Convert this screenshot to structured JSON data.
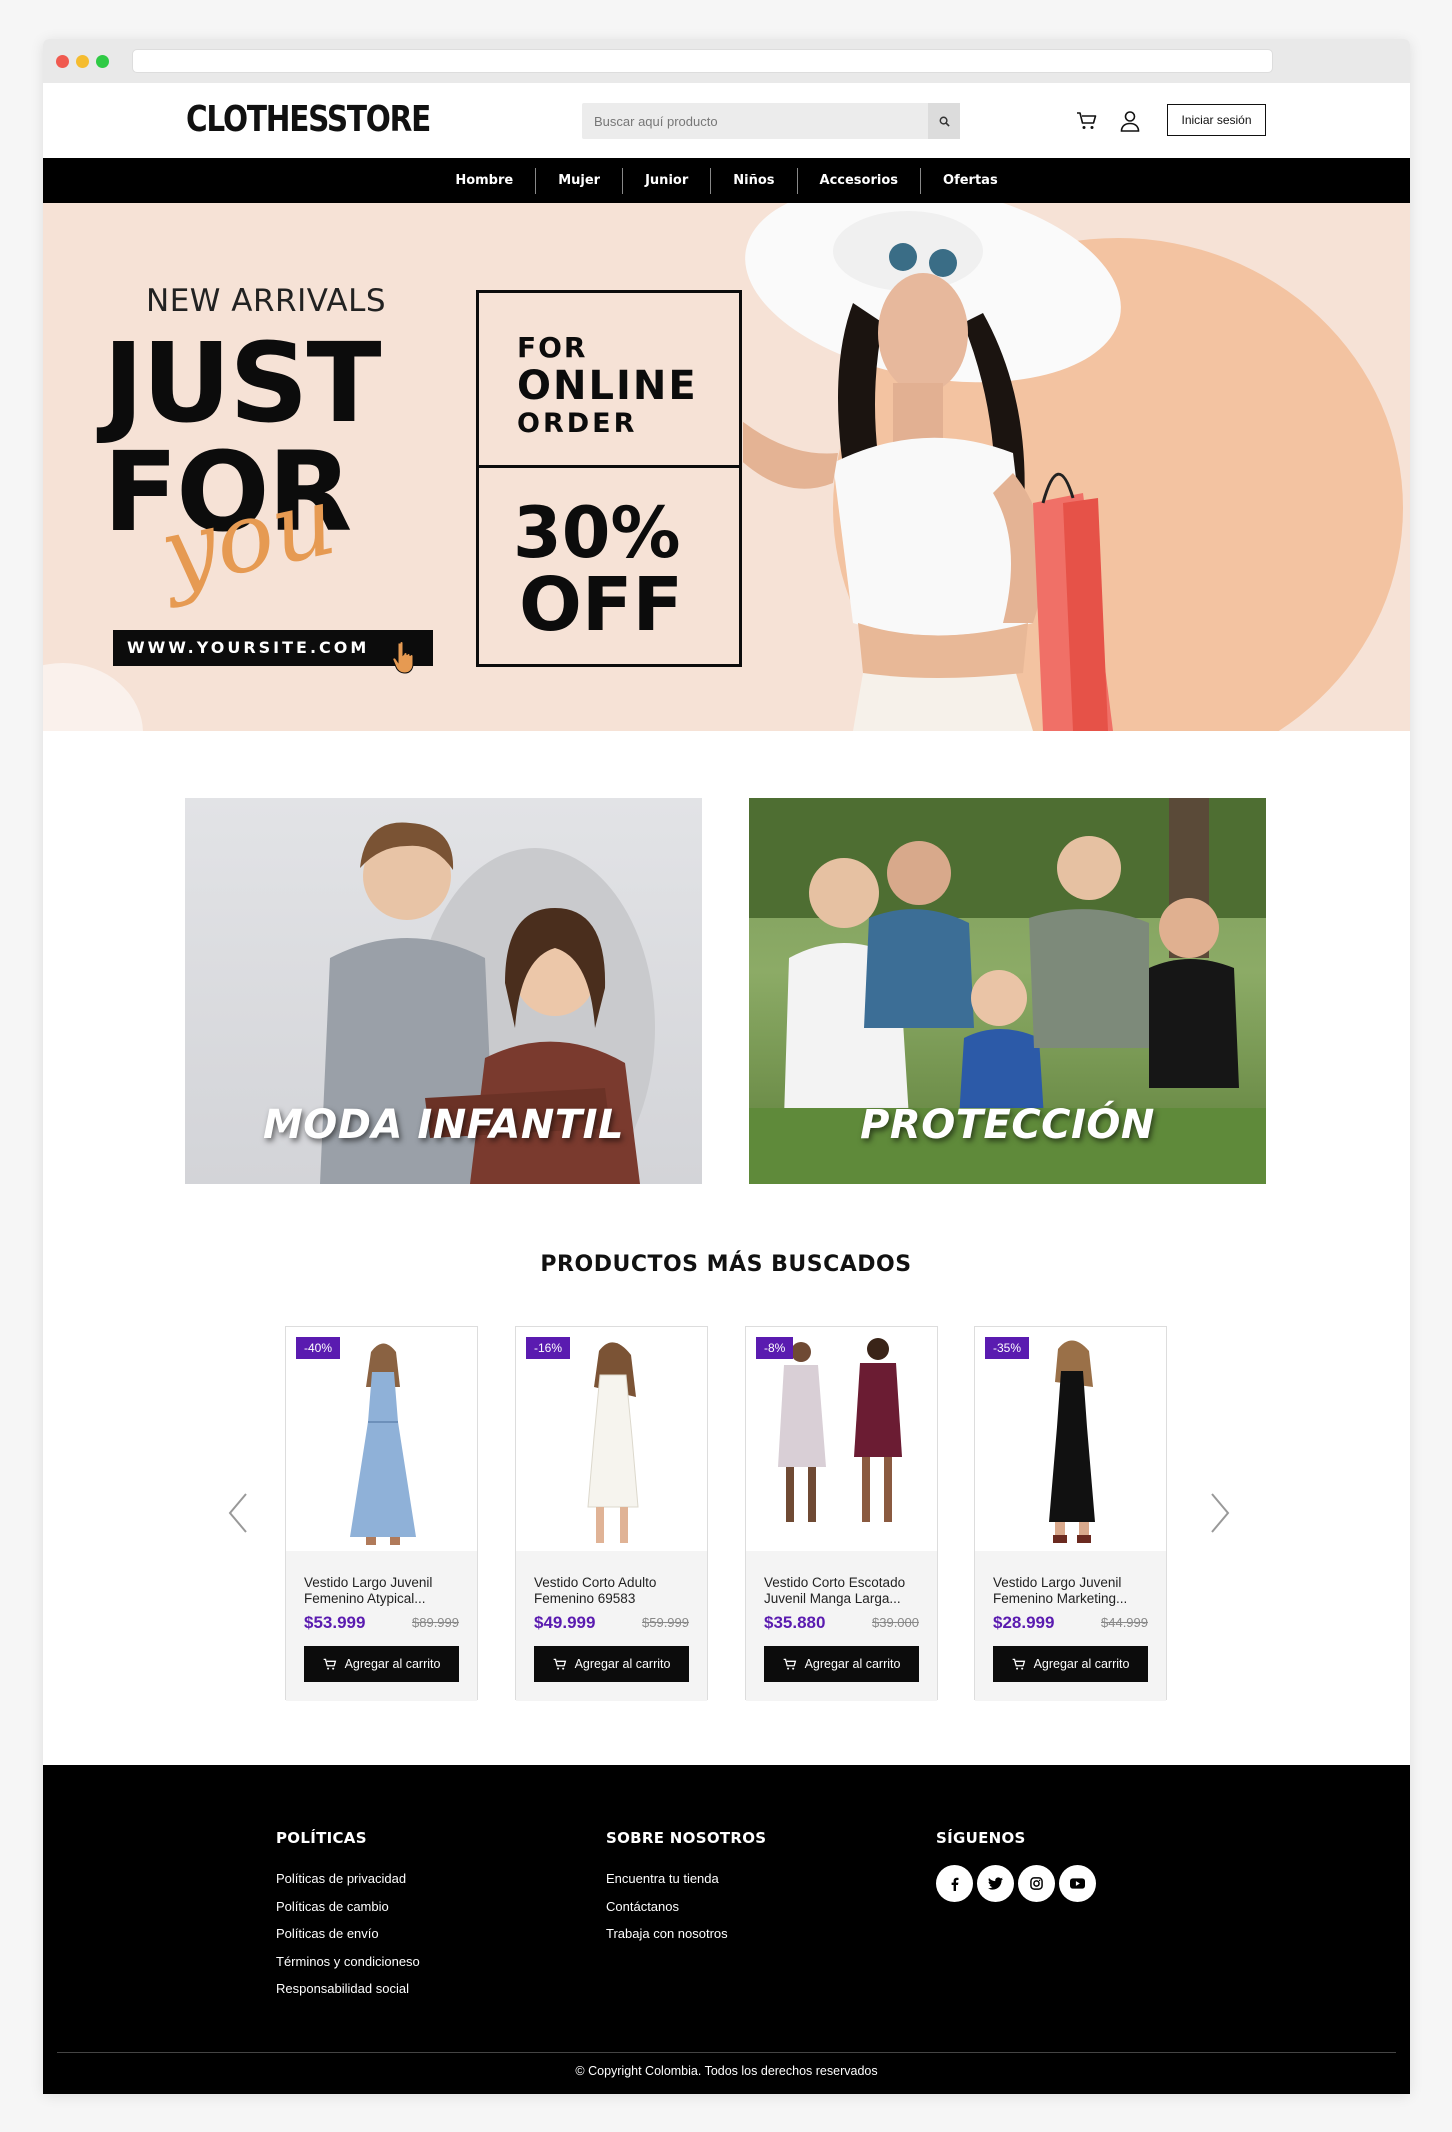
{
  "header": {
    "logo": "CLOTHESSTORE",
    "search_placeholder": "Buscar aquí producto",
    "login_label": "Iniciar sesión"
  },
  "nav": {
    "items": [
      "Hombre",
      "Mujer",
      "Junior",
      "Niños",
      "Accesorios",
      "Ofertas"
    ]
  },
  "hero": {
    "new_arrivals": "NEW ARRIVALS",
    "just": "JUST",
    "for": "FOR",
    "you": "you",
    "site": "WWW.YOURSITE.COM",
    "for_small": "FOR",
    "online": "ONLINE",
    "order": "ORDER",
    "percent": "30%",
    "off": "OFF",
    "colors": {
      "background": "#f6e2d6",
      "circle": "#f3c3a1",
      "accent": "#e69a52"
    }
  },
  "categories": [
    {
      "label": "MODA INFANTIL"
    },
    {
      "label": "PROTECCIÓN"
    }
  ],
  "products": {
    "title": "PRODUCTOS MÁS BUSCADOS",
    "add_label": "Agregar al carrito",
    "items": [
      {
        "badge": "-40%",
        "name": "Vestido Largo Juvenil Femenino Atypical...",
        "price": "$53.999",
        "old_price": "$89.999"
      },
      {
        "badge": "-16%",
        "name": "Vestido Corto Adulto Femenino 69583",
        "price": "$49.999",
        "old_price": "$59.999"
      },
      {
        "badge": "-8%",
        "name": "Vestido Corto Escotado Juvenil Manga Larga...",
        "price": "$35.880",
        "old_price": "$39.000"
      },
      {
        "badge": "-35%",
        "name": "Vestido Largo Juvenil Femenino Marketing...",
        "price": "$28.999",
        "old_price": "$44.999"
      }
    ]
  },
  "footer": {
    "policies_title": "POLÍTICAS",
    "policies": [
      "Políticas de privacidad",
      "Políticas de cambio",
      "Políticas de envío",
      "Términos y condicioneso",
      "Responsabilidad social"
    ],
    "about_title": "SOBRE NOSOTROS",
    "about": [
      "Encuentra tu tienda",
      "Contáctanos",
      "Trabaja con nosotros"
    ],
    "follow_title": "SÍGUENOS",
    "social_icons": [
      "facebook-icon",
      "twitter-icon",
      "instagram-icon",
      "youtube-icon"
    ],
    "copyright": "© Copyright Colombia. Todos los derechos reservados"
  },
  "colors": {
    "accent": "#5a1bb0",
    "nav_bg": "#000000"
  }
}
